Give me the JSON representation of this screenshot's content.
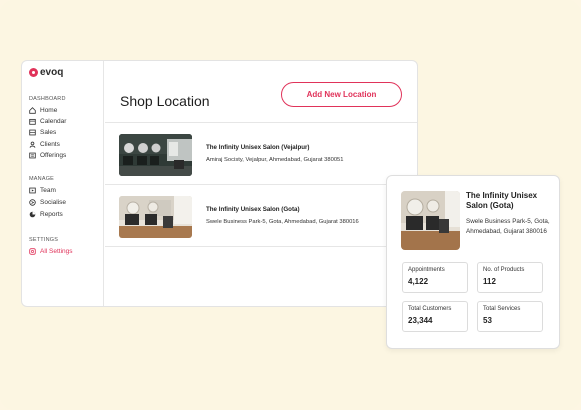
{
  "brand": {
    "name": "evoq",
    "accent": "#e0335a"
  },
  "sidebar": {
    "sections": [
      {
        "title": "DASHBOARD",
        "items": [
          {
            "label": "Home",
            "icon": "home-icon"
          },
          {
            "label": "Calendar",
            "icon": "calendar-icon"
          },
          {
            "label": "Sales",
            "icon": "sales-icon"
          },
          {
            "label": "Clients",
            "icon": "clients-icon"
          },
          {
            "label": "Offerings",
            "icon": "offerings-icon"
          }
        ]
      },
      {
        "title": "MANAGE",
        "items": [
          {
            "label": "Team",
            "icon": "team-icon"
          },
          {
            "label": "Socialise",
            "icon": "socialise-icon"
          },
          {
            "label": "Reports",
            "icon": "reports-icon"
          }
        ]
      },
      {
        "title": "SETTINGS",
        "items": [
          {
            "label": "All Settings",
            "icon": "settings-icon",
            "active": true
          }
        ]
      }
    ]
  },
  "main": {
    "title": "Shop Location",
    "add_button": "Add New Location",
    "locations": [
      {
        "name": "The Infinity Unisex Salon (Vejalpur)",
        "address": "Amiraj Socisty, Vejalpur, Ahmedabad, Gujarat 380051"
      },
      {
        "name": "The Infinity Unisex Salon (Gota)",
        "address": "Swele Business Park-5, Gota, Ahmedabad, Gujarat 380016"
      }
    ]
  },
  "detail": {
    "name": "The Infinity Unisex Salon (Gota)",
    "address": "Swele Business Park-5, Gota, Ahmedabad, Gujarat 380016",
    "stats": [
      {
        "label": "Appointments",
        "value": "4,122"
      },
      {
        "label": "No. of Products",
        "value": "112"
      },
      {
        "label": "Total Customers",
        "value": "23,344"
      },
      {
        "label": "Total Services",
        "value": "53"
      }
    ]
  }
}
